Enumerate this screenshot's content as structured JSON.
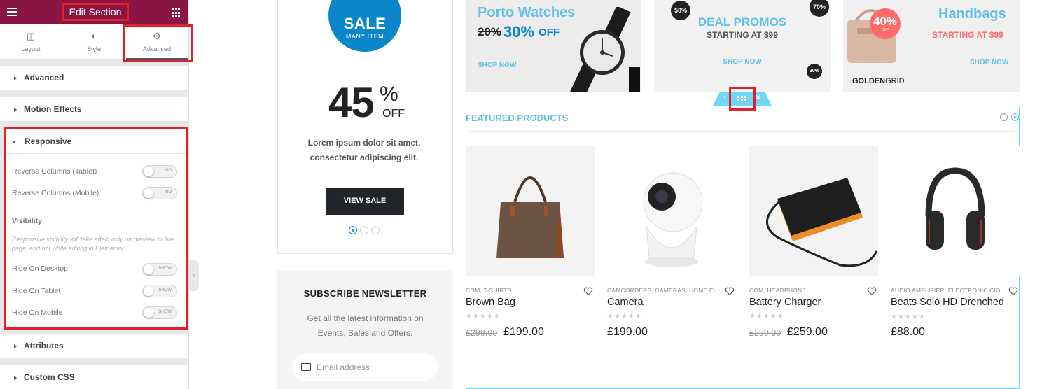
{
  "panel": {
    "title": "Edit Section",
    "tabs": [
      {
        "label": "Layout",
        "icon": "layout-icon"
      },
      {
        "label": "Style",
        "icon": "style-icon"
      },
      {
        "label": "Advanced",
        "icon": "gear-icon"
      }
    ],
    "sections": {
      "advanced": "Advanced",
      "motion": "Motion Effects",
      "responsive": "Responsive",
      "attributes": "Attributes",
      "custom_css": "Custom CSS"
    },
    "responsive": {
      "reverse_tablet": {
        "label": "Reverse Columns (Tablet)",
        "state": "NO"
      },
      "reverse_mobile": {
        "label": "Reverse Columns (Mobile)",
        "state": "NO"
      },
      "visibility_title": "Visibility",
      "visibility_note": "Responsive visibility will take effect only on preview or live page, and not while editing in Elementor.",
      "hide_desktop": {
        "label": "Hide On Desktop",
        "state": "SHOW"
      },
      "hide_tablet": {
        "label": "Hide On Tablet",
        "state": "SHOW"
      },
      "hide_mobile": {
        "label": "Hide On Mobile",
        "state": "SHOW"
      }
    }
  },
  "sale": {
    "badge_big": "SALE",
    "badge_small": "MANY ITEM",
    "percent": "45",
    "percent_sign": "%",
    "off": "OFF",
    "text": "Lorem ipsum dolor sit amet, consectetur adipiscing elit.",
    "button": "VIEW SALE"
  },
  "newsletter": {
    "title": "SUBSCRIBE NEWSLETTER",
    "text": "Get all the latest information on Events, Sales and Offers.",
    "placeholder": "Email address"
  },
  "banners": {
    "watches": {
      "title": "Porto Watches",
      "old": "20%",
      "new": "30%",
      "off": "OFF",
      "shop": "SHOP NOW"
    },
    "deal": {
      "title": "DEAL PROMOS",
      "sub": "STARTING AT $99",
      "shop": "SHOP NOW",
      "b1": "50%",
      "b2": "70%",
      "b3": "30%"
    },
    "handbags": {
      "title": "Handbags",
      "sub": "STARTING AT $99",
      "badge": "40%",
      "badge_off": "OFF",
      "shop": "SHOP NOW",
      "brand_a": "GOLDEN",
      "brand_b": "GRID."
    }
  },
  "featured": {
    "title": "FEATURED PRODUCTS",
    "products": [
      {
        "cat": "COM, T-SHIRTS",
        "name": "Brown Bag",
        "old": "£299.00",
        "price": "£199.00"
      },
      {
        "cat": "CAMCORDERS, CAMERAS, HOME EL...",
        "name": "Camera",
        "old": "",
        "price": "£199.00"
      },
      {
        "cat": "COM, HEADPHONE",
        "name": "Battery Charger",
        "old": "£299.00",
        "price": "£259.00"
      },
      {
        "cat": "AUDIO AMPLIFIER, ELECTRONIC CIG...",
        "name": "Beats Solo HD Drenched",
        "old": "",
        "price": "£88.00"
      }
    ]
  },
  "colors": {
    "elementor": "#8a1542",
    "highlight": "#e3202a",
    "accent": "#5fc1e7",
    "sale_blue": "#0b86cb"
  }
}
